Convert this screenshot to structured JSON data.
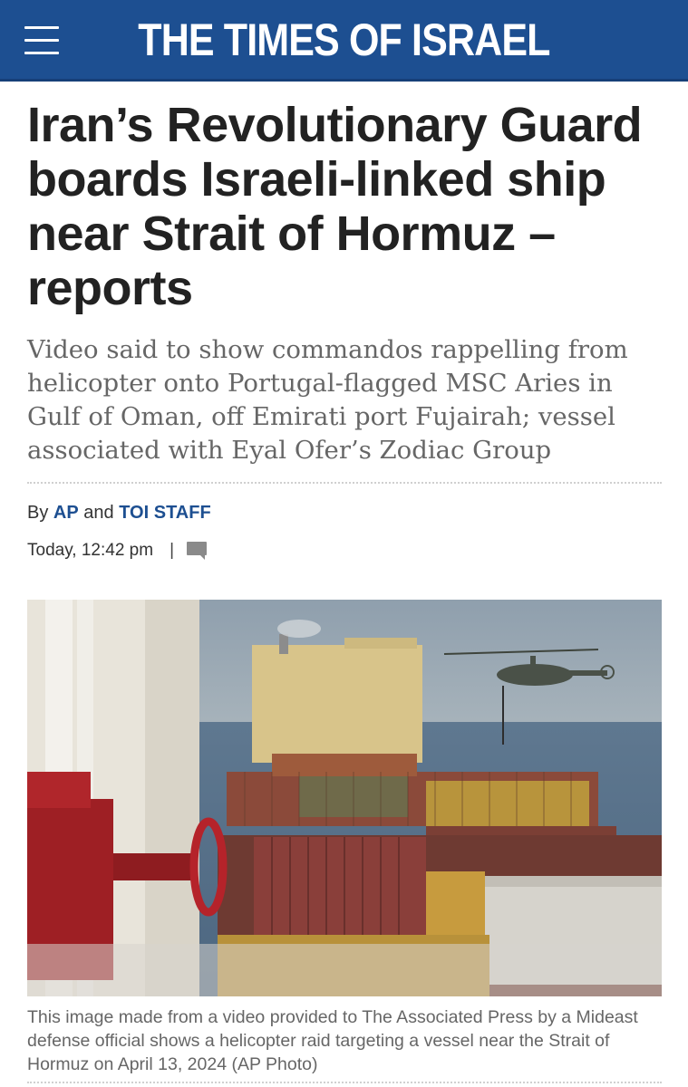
{
  "header": {
    "logo_text": "THE TIMES OF ISRAEL",
    "menu_icon": "hamburger-menu-icon",
    "background_color": "#1d4f91"
  },
  "article": {
    "headline": "Iran’s Revolutionary Guard boards Israeli-linked ship near Strait of Hormuz – reports",
    "subhead": "Video said to show commandos rappelling from helicopter onto Portugal-flagged MSC Aries in Gulf of Oman, off Emirati port Fujairah; vessel associated with Eyal Ofer’s Zodiac Group",
    "byline": {
      "prefix": "By",
      "author1": "AP",
      "conjunction": "and",
      "author2": "TOI STAFF"
    },
    "timestamp": "Today, 12:42 pm",
    "separator": "|",
    "comment_icon": "comment-icon",
    "image": {
      "caption": "This image made from a video provided to The Associated Press by a Mideast defense official shows a helicopter raid targeting a vessel near the Strait of Hormuz on April 13, 2024 (AP Photo)"
    }
  },
  "colors": {
    "accent": "#1d4f91",
    "headline": "#222222",
    "subhead": "#666666"
  }
}
